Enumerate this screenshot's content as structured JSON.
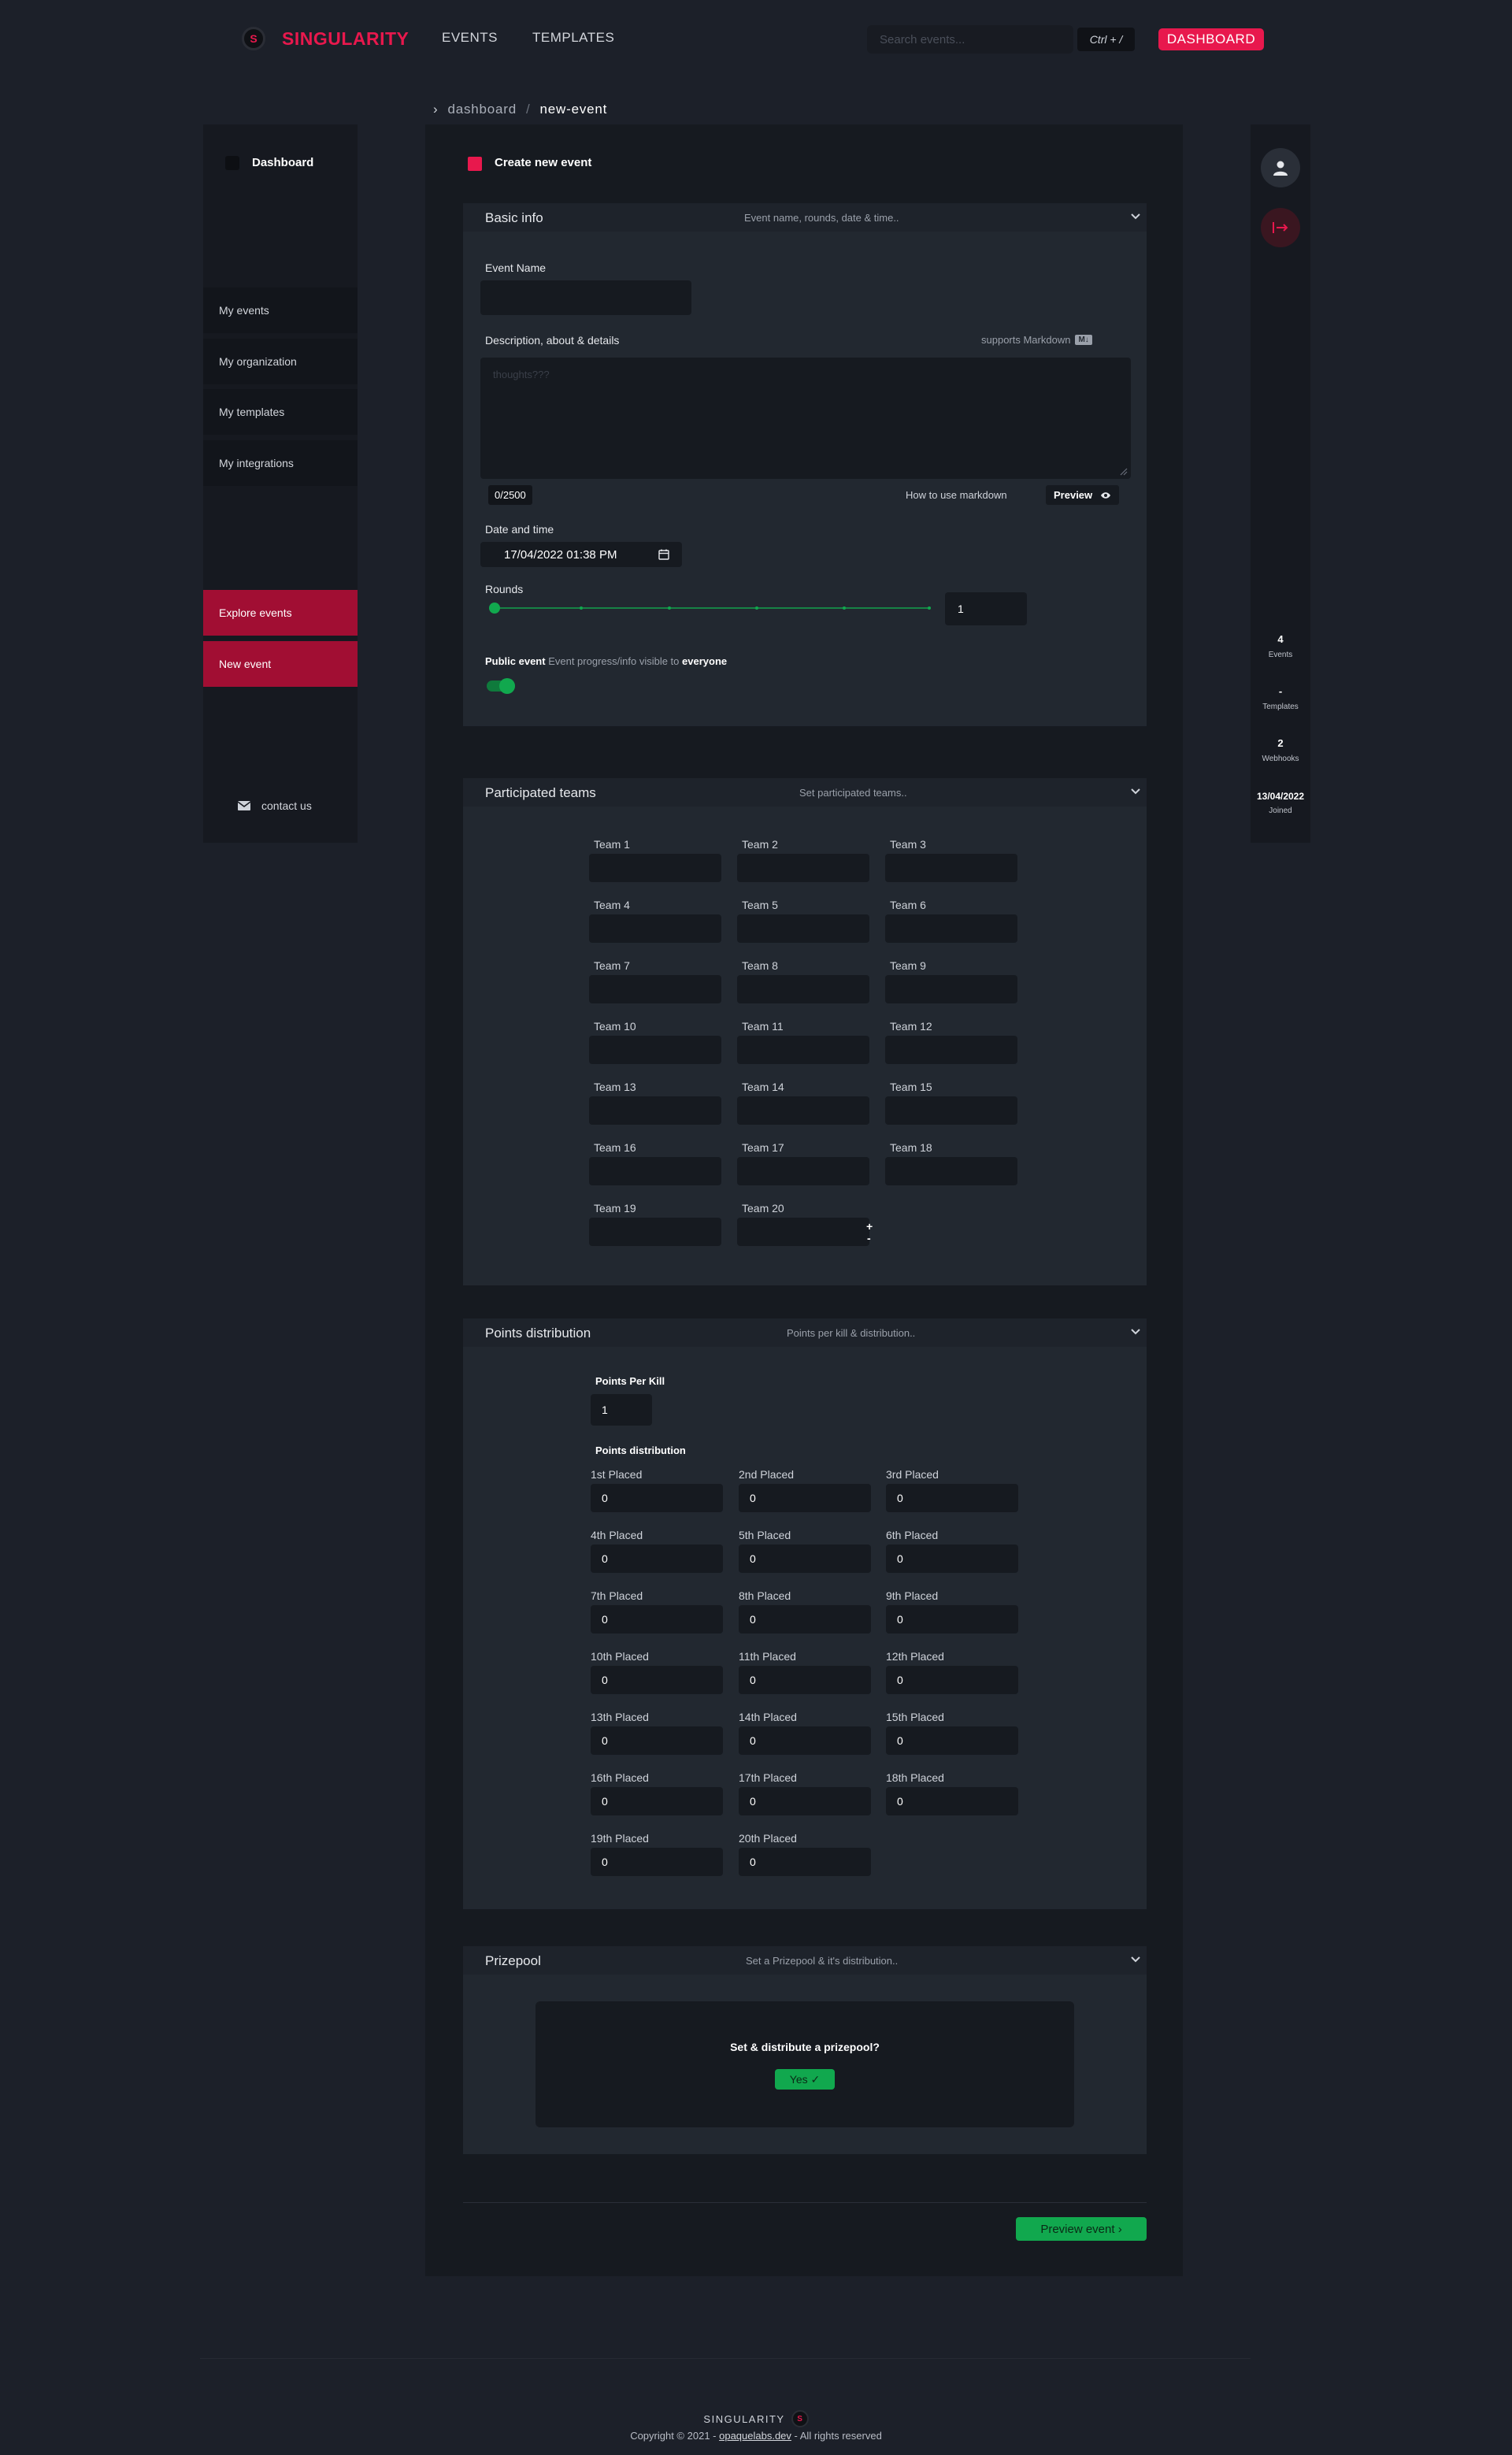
{
  "nav": {
    "brand": "SINGULARITY",
    "logo_glyph": "S",
    "links": [
      "EVENTS",
      "TEMPLATES"
    ],
    "search_placeholder": "Search events...",
    "search_shortcut": "Ctrl + /",
    "dashboard_button": "DASHBOARD"
  },
  "breadcrumb": {
    "sep_icon": "›",
    "root": "dashboard",
    "sep": "/",
    "current": "new-event"
  },
  "sidebar": {
    "title": "Dashboard",
    "items": [
      {
        "label": "My events"
      },
      {
        "label": "My organization"
      },
      {
        "label": "My templates"
      },
      {
        "label": "My integrations"
      }
    ],
    "actions": [
      {
        "label": "Explore events"
      },
      {
        "label": "New event"
      }
    ],
    "contact": "contact us"
  },
  "rail": {
    "stats": [
      {
        "value": "4",
        "label": "Events"
      },
      {
        "value": "-",
        "label": "Templates"
      },
      {
        "value": "2",
        "label": "Webhooks"
      },
      {
        "value": "13/04/2022",
        "label": "Joined"
      }
    ]
  },
  "main": {
    "title": "Create new event",
    "basic": {
      "title": "Basic info",
      "subtitle": "Event name, rounds, date & time..",
      "event_name_label": "Event Name",
      "event_name_value": "",
      "desc_label": "Description, about & details",
      "markdown_note": "supports Markdown",
      "markdown_badge": "M↓",
      "desc_placeholder": "thoughts???",
      "char_count": "0/2500",
      "howto": "How to use markdown",
      "preview": "Preview",
      "date_label": "Date and time",
      "date_value": "17/04/2022 01:38 PM",
      "rounds_label": "Rounds",
      "rounds_value": "1",
      "public_label": "Public event",
      "public_desc": "Event progress/info visible to",
      "public_desc_bold": "everyone",
      "public_toggle": true
    },
    "teams": {
      "title": "Participated teams",
      "subtitle": "Set participated teams..",
      "labels": [
        "Team 1",
        "Team 2",
        "Team 3",
        "Team 4",
        "Team 5",
        "Team 6",
        "Team 7",
        "Team 8",
        "Team 9",
        "Team 10",
        "Team 11",
        "Team 12",
        "Team 13",
        "Team 14",
        "Team 15",
        "Team 16",
        "Team 17",
        "Team 18",
        "Team 19",
        "Team 20"
      ],
      "values": [
        "",
        "",
        "",
        "",
        "",
        "",
        "",
        "",
        "",
        "",
        "",
        "",
        "",
        "",
        "",
        "",
        "",
        "",
        "",
        ""
      ],
      "add": "+",
      "remove": "-"
    },
    "points": {
      "title": "Points distribution",
      "subtitle": "Points per kill & distribution..",
      "ppk_label": "Points Per Kill",
      "ppk_value": "1",
      "dist_label": "Points distribution",
      "places": [
        "1st Placed",
        "2nd Placed",
        "3rd Placed",
        "4th Placed",
        "5th Placed",
        "6th Placed",
        "7th Placed",
        "8th Placed",
        "9th Placed",
        "10th Placed",
        "11th Placed",
        "12th Placed",
        "13th Placed",
        "14th Placed",
        "15th Placed",
        "16th Placed",
        "17th Placed",
        "18th Placed",
        "19th Placed",
        "20th Placed"
      ],
      "values": [
        "0",
        "0",
        "0",
        "0",
        "0",
        "0",
        "0",
        "0",
        "0",
        "0",
        "0",
        "0",
        "0",
        "0",
        "0",
        "0",
        "0",
        "0",
        "0",
        "0"
      ]
    },
    "prizepool": {
      "title": "Prizepool",
      "subtitle": "Set a Prizepool & it's distribution..",
      "question": "Set & distribute a prizepool?",
      "yes": "Yes ✓"
    },
    "preview_button": "Preview event  ›"
  },
  "footer": {
    "brand": "SINGULARITY",
    "copyright": "Copyright © 2021 - ",
    "link": "opaquelabs.dev",
    "rights": " - All rights reserved"
  },
  "colors": {
    "accent": "#e8184d",
    "green": "#11a84e",
    "bg": "#1c2029"
  }
}
